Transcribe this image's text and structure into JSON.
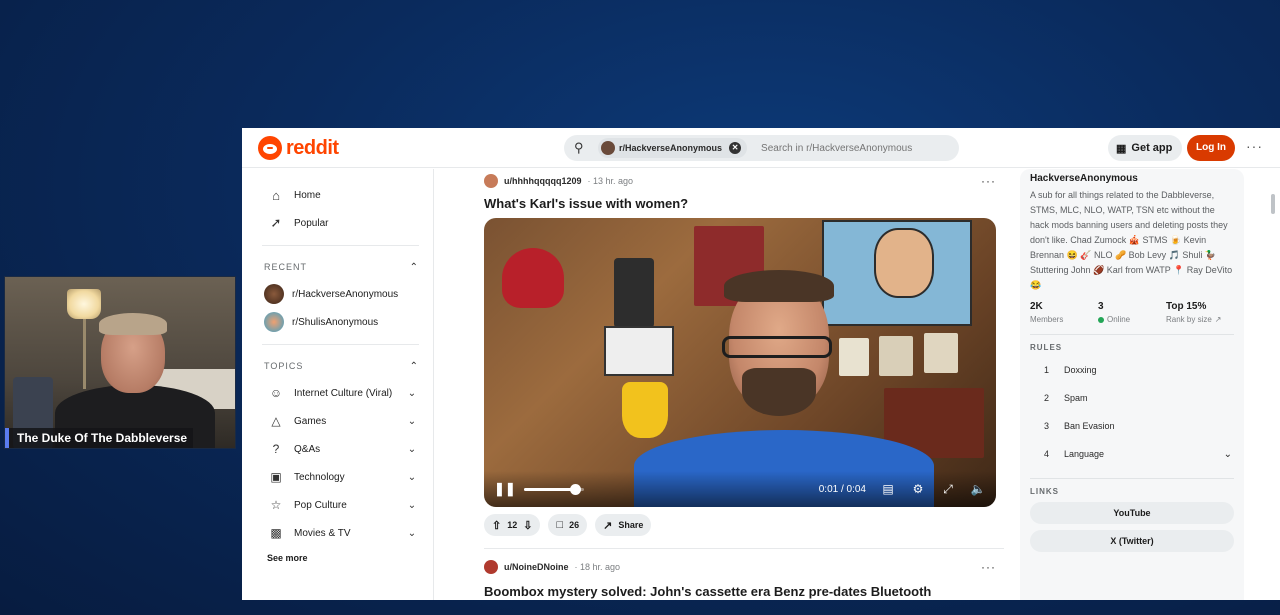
{
  "webcam": {
    "caption": "The Duke Of The Dabbleverse"
  },
  "header": {
    "logo_text": "reddit",
    "search_chip": "r/HackverseAnonymous",
    "search_placeholder": "Search in r/HackverseAnonymous",
    "get_app": "Get app",
    "login": "Log In",
    "more": "···"
  },
  "leftnav": {
    "home": "Home",
    "popular": "Popular",
    "recent_label": "RECENT",
    "recent": [
      "r/HackverseAnonymous",
      "r/ShulisAnonymous"
    ],
    "topics_label": "TOPICS",
    "topics": [
      {
        "label": "Internet Culture (Viral)",
        "icon": "smile-icon"
      },
      {
        "label": "Games",
        "icon": "gamepad-icon"
      },
      {
        "label": "Q&As",
        "icon": "question-icon"
      },
      {
        "label": "Technology",
        "icon": "chip-icon"
      },
      {
        "label": "Pop Culture",
        "icon": "star-icon"
      },
      {
        "label": "Movies & TV",
        "icon": "clapper-icon"
      }
    ],
    "see_more": "See more"
  },
  "post1": {
    "user": "u/hhhhqqqqq1209",
    "time": "· 13 hr. ago",
    "title": "What's Karl's issue with women?",
    "video": {
      "time": "0:01 / 0:04",
      "volume_fraction": 0.85
    },
    "votes": "12",
    "comments": "26",
    "share": "Share"
  },
  "post2": {
    "user": "u/NoineDNoine",
    "time": "· 18 hr. ago",
    "title": "Boombox mystery solved: John's cassette era Benz pre-dates Bluetooth technology. He's too broke to replace the stereo, so has to connect his iPhone 8 to this device to"
  },
  "sidebar": {
    "name": "HackverseAnonymous",
    "description": "A sub for all things related to the Dabbleverse, STMS, MLC, NLO, WATP, TSN etc without the hack mods banning users and deleting posts they don't like. Chad Zumock 🎪 STMS 🍺 Kevin Brennan 😆 🎸 NLO 🥜 Bob Levy 🎵 Shuli 🦆 Stuttering John 🏈 Karl from WATP 📍 Ray DeVito 😂",
    "members_val": "2K",
    "members_label": "Members",
    "online_val": "3",
    "online_label": "Online",
    "rank_val": "Top 15%",
    "rank_label": "Rank by size",
    "rules_label": "RULES",
    "rules": [
      "Doxxing",
      "Spam",
      "Ban Evasion",
      "Language"
    ],
    "links_label": "LINKS",
    "links": [
      "YouTube",
      "X (Twitter)"
    ]
  },
  "colors": {
    "brand": "#ff4500",
    "login": "#d93a00",
    "online": "#23a556"
  }
}
